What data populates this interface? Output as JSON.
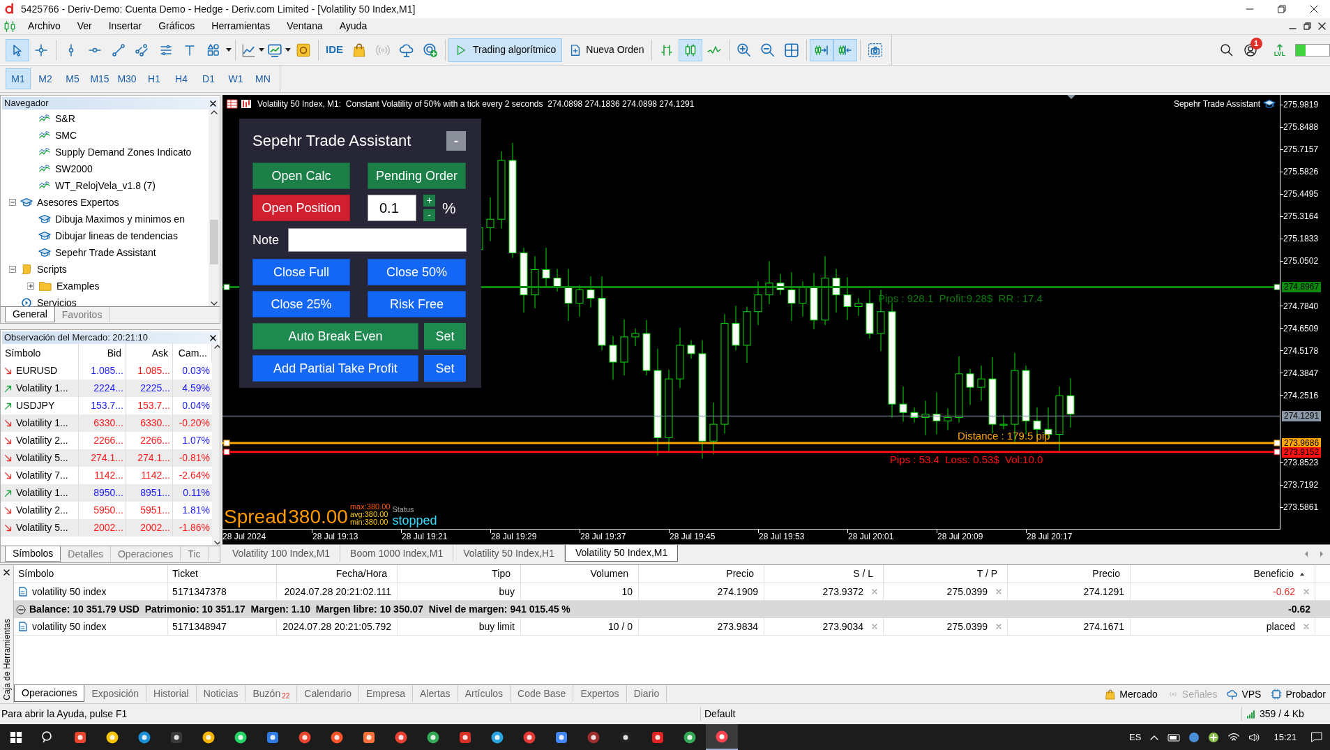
{
  "window": {
    "title": "5425766 - Deriv-Demo: Cuenta Demo - Hedge - Deriv.com Limited - [Volatility 50 Index,M1]"
  },
  "menu": [
    "Archivo",
    "Ver",
    "Insertar",
    "Gráficos",
    "Herramientas",
    "Ventana",
    "Ayuda"
  ],
  "toolbar": {
    "drawing_tools": [
      {
        "selected": true
      },
      {
        "selected": false
      },
      {
        "selected": false
      },
      {
        "selected": false
      },
      {
        "selected": false
      },
      {
        "selected": false
      },
      {
        "selected": false
      },
      {
        "selected": false
      },
      {
        "selected": false
      }
    ],
    "ide": "IDE",
    "algo_trading": {
      "label": "Trading algorítmico",
      "selected": true
    },
    "new_order": "Nueva Orden",
    "chart_types": [
      {
        "selected": false
      },
      {
        "selected": true
      },
      {
        "selected": false
      }
    ],
    "chart_shift": [
      {
        "selected": true
      },
      {
        "selected": true
      }
    ],
    "notifications_badge": "1",
    "lvl_label": "LVL",
    "meter": {
      "level": 0.3
    }
  },
  "timeframes": [
    {
      "label": "M1",
      "selected": true
    },
    {
      "label": "M2",
      "selected": false
    },
    {
      "label": "M5",
      "selected": false
    },
    {
      "label": "M15",
      "selected": false
    },
    {
      "label": "M30",
      "selected": false
    },
    {
      "label": "H1",
      "selected": false
    },
    {
      "label": "H4",
      "selected": false
    },
    {
      "label": "D1",
      "selected": false
    },
    {
      "label": "W1",
      "selected": false
    },
    {
      "label": "MN",
      "selected": false
    }
  ],
  "navigator": {
    "title": "Navegador",
    "tree": [
      {
        "children": [
          {
            "label": "S&R",
            "kind": "indicator"
          },
          {
            "label": "SMC",
            "kind": "indicator"
          },
          {
            "label": "Supply Demand Zones Indicato",
            "kind": "indicator"
          },
          {
            "label": "SW2000",
            "kind": "indicator"
          },
          {
            "label": "WT_RelojVela_v1.8 (7)",
            "kind": "indicator"
          }
        ]
      },
      {
        "label": "Asesores Expertos",
        "kind": "expert",
        "expanded": true,
        "children": [
          {
            "label": "Dibuja Maximos y minimos en",
            "kind": "expert"
          },
          {
            "label": "Dibujar lineas de tendencias",
            "kind": "expert"
          },
          {
            "label": "Sepehr Trade Assistant",
            "kind": "expert"
          }
        ]
      },
      {
        "label": "Scripts",
        "kind": "script",
        "expanded": true,
        "children": [
          {
            "label": "Examples",
            "kind": "folder",
            "expanded": false
          }
        ]
      },
      {
        "label": "Servicios",
        "kind": "service"
      }
    ],
    "tabs": [
      {
        "label": "General",
        "selected": true
      },
      {
        "label": "Favoritos",
        "selected": false
      }
    ]
  },
  "market_watch": {
    "title": "Observación del Mercado: 20:21:10",
    "columns": [
      "Símbolo",
      "Bid",
      "Ask",
      "Cam..."
    ],
    "rows": [
      {
        "symbol": "EURUSD",
        "bid": "1.085...",
        "ask": "1.085...",
        "change": "0.03%",
        "rising": false,
        "bid_rising": true,
        "ask_rising": false,
        "change_rising": true
      },
      {
        "symbol": "Volatility 1...",
        "bid": "2224...",
        "ask": "2225...",
        "change": "4.59%",
        "rising": true,
        "bid_rising": true,
        "ask_rising": true,
        "change_rising": true
      },
      {
        "symbol": "USDJPY",
        "bid": "153.7...",
        "ask": "153.7...",
        "change": "0.04%",
        "rising": true,
        "bid_rising": true,
        "ask_rising": false,
        "change_rising": true
      },
      {
        "symbol": "Volatility 1...",
        "bid": "6330...",
        "ask": "6330...",
        "change": "-0.20%",
        "rising": false,
        "bid_rising": false,
        "ask_rising": false,
        "change_rising": false
      },
      {
        "symbol": "Volatility 2...",
        "bid": "2266...",
        "ask": "2266...",
        "change": "1.07%",
        "rising": false,
        "bid_rising": false,
        "ask_rising": false,
        "change_rising": true
      },
      {
        "symbol": "Volatility 5...",
        "bid": "274.1...",
        "ask": "274.1...",
        "change": "-0.81%",
        "rising": false,
        "bid_rising": false,
        "ask_rising": false,
        "change_rising": false
      },
      {
        "symbol": "Volatility 7...",
        "bid": "1142...",
        "ask": "1142...",
        "change": "-2.64%",
        "rising": false,
        "bid_rising": false,
        "ask_rising": false,
        "change_rising": false
      },
      {
        "symbol": "Volatility 1...",
        "bid": "8950...",
        "ask": "8951...",
        "change": "0.11%",
        "rising": true,
        "bid_rising": true,
        "ask_rising": true,
        "change_rising": true
      },
      {
        "symbol": "Volatility 2...",
        "bid": "5950...",
        "ask": "5951...",
        "change": "1.81%",
        "rising": false,
        "bid_rising": false,
        "ask_rising": false,
        "change_rising": true
      },
      {
        "symbol": "Volatility 5...",
        "bid": "2002...",
        "ask": "2002...",
        "change": "-1.86%",
        "rising": false,
        "bid_rising": false,
        "ask_rising": false,
        "change_rising": false
      }
    ],
    "tabs": [
      {
        "label": "Símbolos",
        "selected": true
      },
      {
        "label": "Detalles",
        "selected": false
      },
      {
        "label": "Operaciones",
        "selected": false
      },
      {
        "label": "Tic",
        "selected": false
      }
    ]
  },
  "chart": {
    "header": "Volatility 50 Index, M1:  Constant Volatility of 50% with a tick every 2 seconds  274.0898 274.1836 274.0898 274.1291",
    "expert_label": "Sepehr Trade Assistant",
    "price_ticks": [
      "275.9819",
      "275.8488",
      "275.7157",
      "275.5826",
      "275.4495",
      "275.3164",
      "275.1833",
      "275.0502",
      "274.7840",
      "274.6509",
      "274.5178",
      "274.3847",
      "274.2516",
      "273.8523",
      "273.7192",
      "273.5861"
    ],
    "time_labels": [
      "28 Jul 2024",
      "28 Jul 19:13",
      "28 Jul 19:21",
      "28 Jul 19:29",
      "28 Jul 19:37",
      "28 Jul 19:45",
      "28 Jul 19:53",
      "28 Jul 20:01",
      "28 Jul 20:09",
      "28 Jul 20:17"
    ],
    "current_price": "274.1291",
    "levels": [
      {
        "kind": "take-profit",
        "price": "274.8967",
        "text": "Pips : 928.1  Profit:9.28$  RR : 17.4"
      },
      {
        "kind": "entry",
        "price": "273.9686",
        "text": "Distance : 179.5 pip"
      },
      {
        "kind": "stop-loss",
        "price": "273.9152",
        "text": "Pips : 53.4  Loss: 0.53$  Vol:10.0"
      }
    ],
    "spread": {
      "label": "Spread",
      "value": "380.00",
      "max": "max:380.00",
      "avg": "avg:380.00",
      "min": "min:380.00",
      "status_label": "Status",
      "status": "stopped"
    }
  },
  "trade_panel": {
    "title": "Sepehr Trade Assistant",
    "minimize": "-",
    "buttons": [
      {
        "label": "Open Calc",
        "color": "#1b7f47"
      },
      {
        "label": "Pending Order",
        "color": "#1b7f47"
      },
      {
        "label": "Open Position",
        "color": "#d21f2f"
      }
    ],
    "risk": {
      "value": "0.1",
      "plus": "+",
      "minus": "-",
      "unit": "%"
    },
    "note": {
      "label": "Note"
    },
    "actions": [
      {
        "label": "Close Full",
        "color": "#1466f5"
      },
      {
        "label": "Close 50%",
        "color": "#1466f5"
      },
      {
        "label": "Close 25%",
        "color": "#1466f5"
      },
      {
        "label": "Risk Free",
        "color": "#1466f5"
      }
    ],
    "settings": [
      {
        "label": "Auto Break Even",
        "set": "Set",
        "color": "#1e8a50"
      },
      {
        "label": "Add Partial Take Profit",
        "set": "Set",
        "color": "#1466f5"
      }
    ]
  },
  "chart_tabs": [
    {
      "label": "Volatility 100 Index,M1",
      "selected": false
    },
    {
      "label": "Boom 1000 Index,M1",
      "selected": false
    },
    {
      "label": "Volatility 50 Index,H1",
      "selected": false
    },
    {
      "label": "Volatility 50 Index,M1",
      "selected": true
    }
  ],
  "toolbox": {
    "side_label": "Caja de Herramientas",
    "columns": [
      "Símbolo",
      "Ticket",
      "Fecha/Hora",
      "Tipo",
      "Volumen",
      "Precio",
      "S / L",
      "T / P",
      "Precio",
      "Beneficio"
    ],
    "rows": [
      {
        "kind": "position",
        "profit_negative": true,
        "cells": [
          "volatility 50 index",
          "5171347378",
          "2024.07.28 20:21:02.111",
          "buy",
          "10",
          "274.1909",
          "273.9372",
          "275.0399",
          "274.1291",
          "-0.62"
        ]
      },
      {
        "kind": "summary",
        "text": "Balance: 10 351.79 USD  Patrimonio: 10 351.17  Margen: 1.10  Margen libre: 10 350.07  Nivel de margen: 941 015.45 %",
        "profit": "-0.62"
      },
      {
        "kind": "order",
        "profit_negative": false,
        "cells": [
          "volatility 50 index",
          "5171348947",
          "2024.07.28 20:21:05.792",
          "buy limit",
          "10 / 0",
          "273.9834",
          "273.9034",
          "275.0399",
          "274.1671",
          "placed"
        ]
      }
    ],
    "tabs": [
      {
        "label": "Operaciones",
        "selected": true
      },
      {
        "label": "Exposición",
        "selected": false
      },
      {
        "label": "Historial",
        "selected": false
      },
      {
        "label": "Noticias",
        "selected": false
      },
      {
        "label": "Buzón",
        "badge": "22",
        "selected": false
      },
      {
        "label": "Calendario",
        "selected": false
      },
      {
        "label": "Empresa",
        "selected": false
      },
      {
        "label": "Alertas",
        "selected": false
      },
      {
        "label": "Artículos",
        "selected": false
      },
      {
        "label": "Code Base",
        "selected": false
      },
      {
        "label": "Expertos",
        "selected": false
      },
      {
        "label": "Diario",
        "selected": false
      }
    ],
    "services": [
      {
        "label": "Mercado",
        "disabled": false
      },
      {
        "label": "Señales",
        "disabled": true
      },
      {
        "label": "VPS",
        "disabled": false
      },
      {
        "label": "Probador",
        "disabled": false
      }
    ]
  },
  "status_bar": {
    "help": "Para abrir la Ayuda, pulse F1",
    "profile": "Default",
    "traffic": "359 / 4 Kb"
  },
  "taskbar": {
    "language": "ES",
    "time": "15:21"
  }
}
